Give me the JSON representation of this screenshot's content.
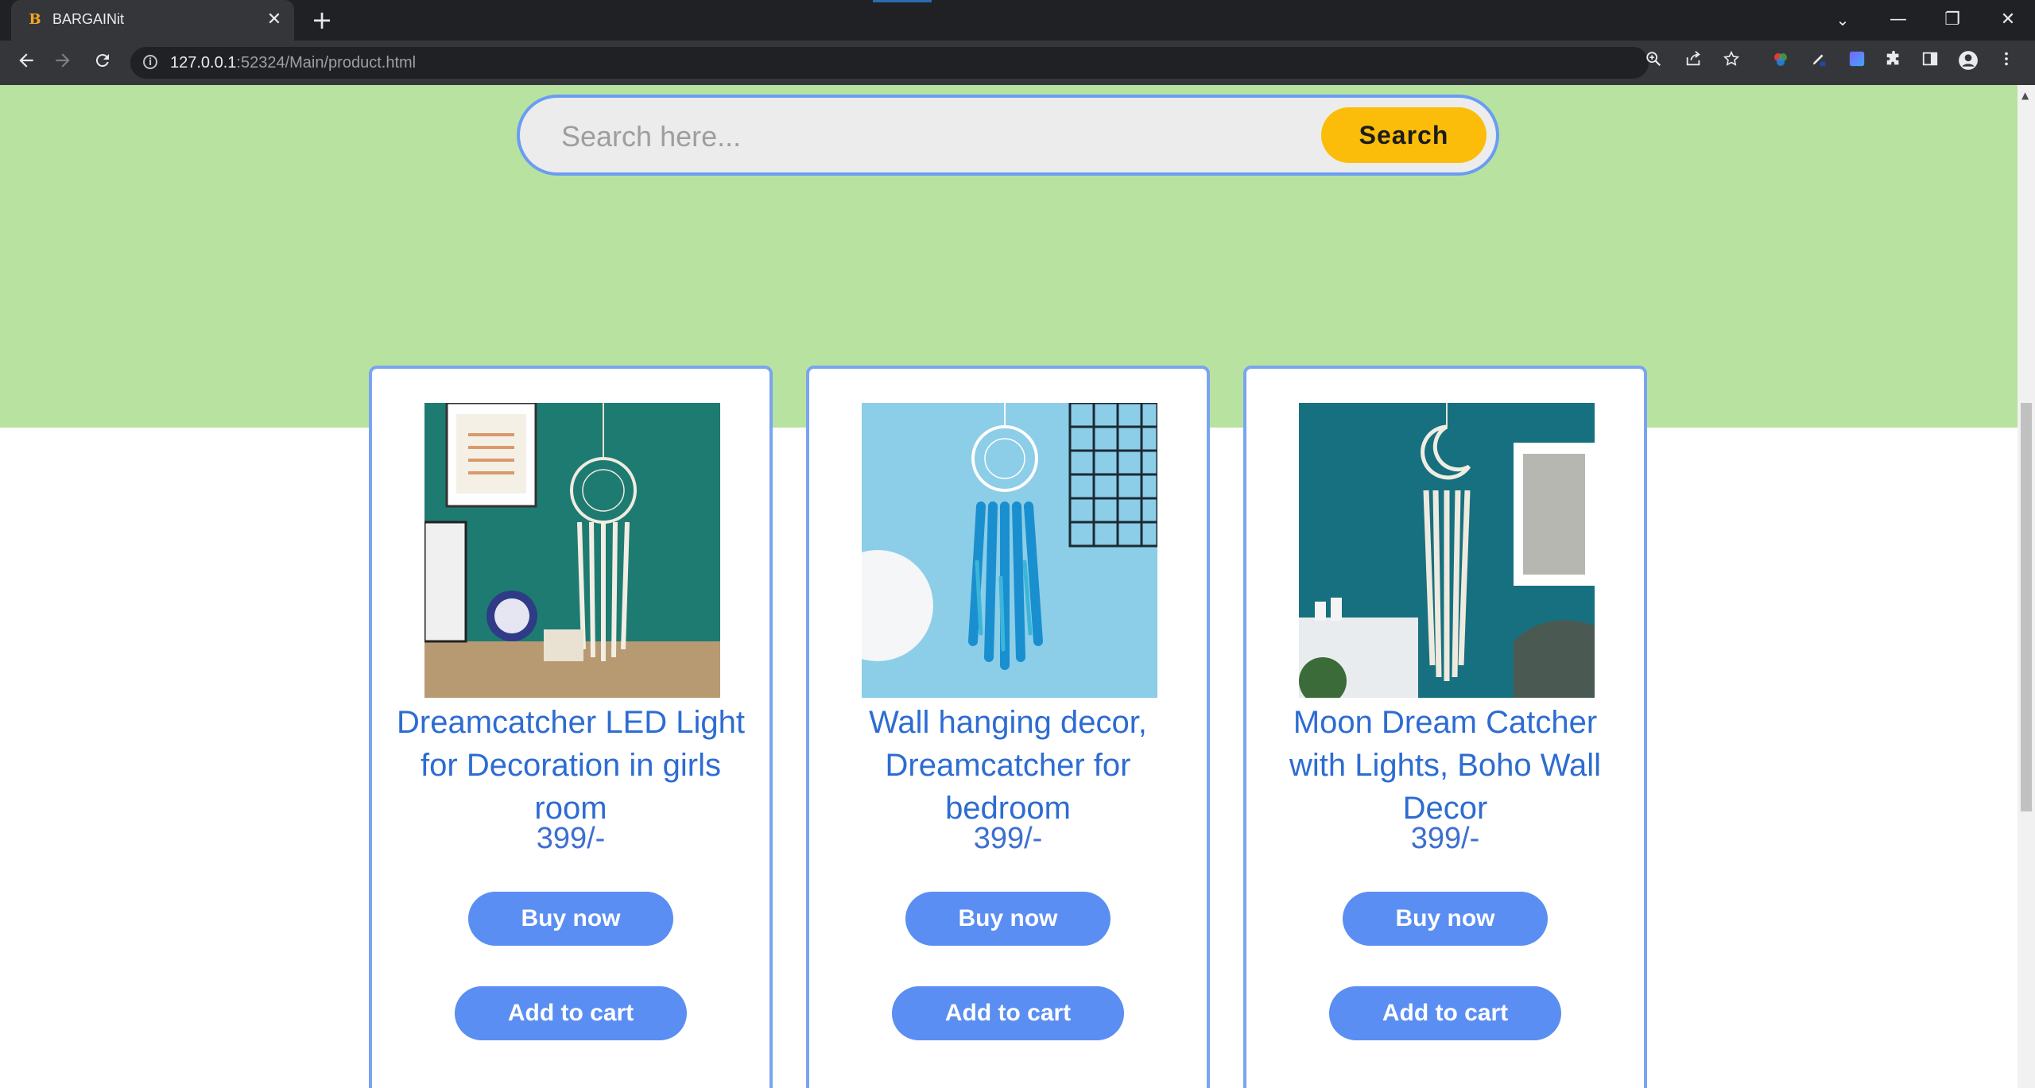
{
  "browser": {
    "tab_favicon": "B",
    "tab_title": "BARGAINit",
    "tab_close": "✕",
    "new_tab": "+",
    "url_host": "127.0.0.1",
    "url_rest": ":52324/Main/product.html",
    "window_controls": {
      "minimize": "—",
      "restore": "❐",
      "close": "✕",
      "tab_search": "⌄"
    }
  },
  "page": {
    "search": {
      "placeholder": "Search here...",
      "button_label": "Search"
    },
    "products": [
      {
        "title": "Dreamcatcher LED Light for Decoration in girls room",
        "price": "399/-",
        "buy_label": "Buy now",
        "cart_label": "Add to cart"
      },
      {
        "title": "Wall hanging decor, Dreamcatcher for bedroom",
        "price": "399/-",
        "buy_label": "Buy now",
        "cart_label": "Add to cart"
      },
      {
        "title": "Moon Dream Catcher with Lights, Boho Wall Decor",
        "price": "399/-",
        "buy_label": "Buy now",
        "cart_label": "Add to cart"
      }
    ]
  },
  "colors": {
    "hero_bg": "#b8e29f",
    "accent_blue": "#5b8ef2",
    "title_blue": "#2d6cd2",
    "search_button": "#fbbd0a"
  },
  "icons": {
    "back": "arrow-left-icon",
    "forward": "arrow-right-icon",
    "reload": "reload-icon",
    "zoom": "zoom-icon",
    "share": "share-icon",
    "bookmark": "star-icon",
    "extensions": "puzzle-icon",
    "profile": "profile-icon",
    "menu": "kebab-menu-icon"
  }
}
